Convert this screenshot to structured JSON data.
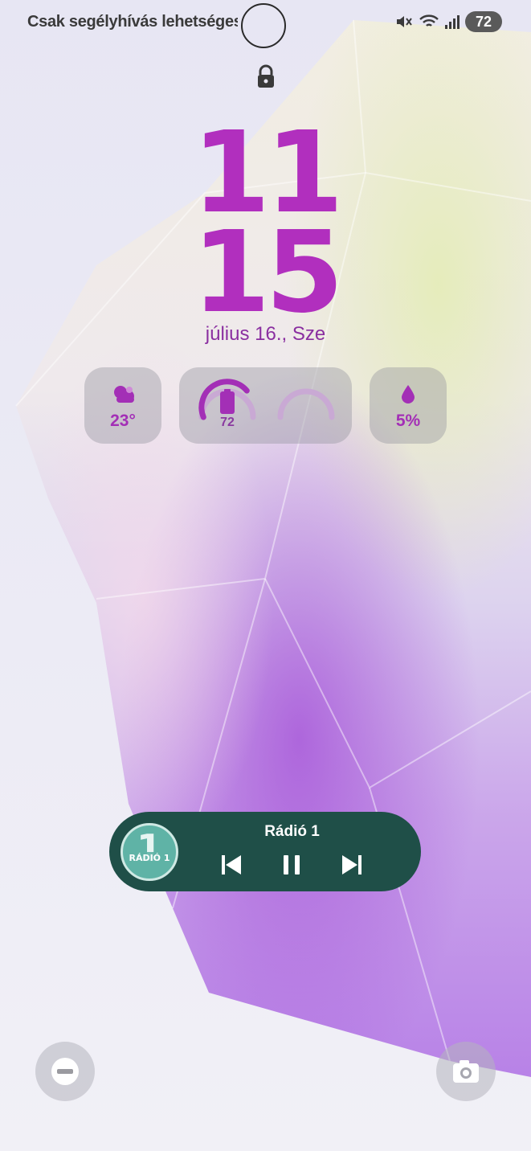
{
  "status_bar": {
    "carrier_text": "Csak segélyhívás lehetséges",
    "battery_level": "72",
    "icons": [
      "mute-icon",
      "wifi-icon",
      "signal-icon"
    ]
  },
  "lock_icon": "lock-icon",
  "clock": {
    "hours": "11",
    "minutes": "15",
    "date": "július 16., Sze"
  },
  "widgets": {
    "weather": {
      "icon": "weather-cloud-icon",
      "value": "23°"
    },
    "battery": {
      "icon": "phone-battery-icon",
      "value": "72",
      "level": 0.72
    },
    "secondary_gauge": {
      "icon": "empty-gauge-icon"
    },
    "rain": {
      "icon": "water-drop-icon",
      "value": "5%"
    }
  },
  "media_player": {
    "title": "Rádió 1",
    "logo_text": "RÁDIÓ 1",
    "logo_digit": "1",
    "controls": [
      "previous",
      "pause",
      "next"
    ]
  },
  "shortcuts": {
    "left": "do-not-disturb-icon",
    "right": "camera-icon"
  },
  "colors": {
    "accent": "#b12fbe",
    "media_bg": "#1f4f48",
    "widget_bg": "rgba(150,150,160,0.42)"
  }
}
